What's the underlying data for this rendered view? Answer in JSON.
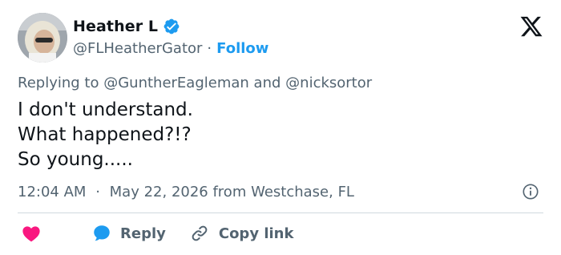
{
  "author": {
    "display_name": "Heather L",
    "handle": "@FLHeatherGator",
    "separator": "·",
    "follow_label": "Follow"
  },
  "reply_context": {
    "prefix": "Replying to",
    "mention_1": "@GuntherEagleman",
    "conjunction": "and",
    "mention_2": "@nicksortor"
  },
  "tweet": {
    "lines": [
      "I don't understand.",
      "What happened?!?",
      "So young....."
    ]
  },
  "meta": {
    "time": "12:04 AM",
    "separator": "·",
    "date_location": "May 22, 2026 from Westchase, FL"
  },
  "actions": {
    "reply_label": "Reply",
    "copy_link_label": "Copy link"
  },
  "icons": {
    "brand": "x-logo-icon",
    "verified": "verified-badge-icon",
    "info": "info-icon",
    "like": "heart-icon",
    "reply": "reply-bubble-icon",
    "copy": "link-icon"
  },
  "colors": {
    "accent": "#1d9bf0",
    "like": "#f91880",
    "muted": "#536471",
    "text": "#0f1419",
    "divider": "#cfd9de"
  }
}
